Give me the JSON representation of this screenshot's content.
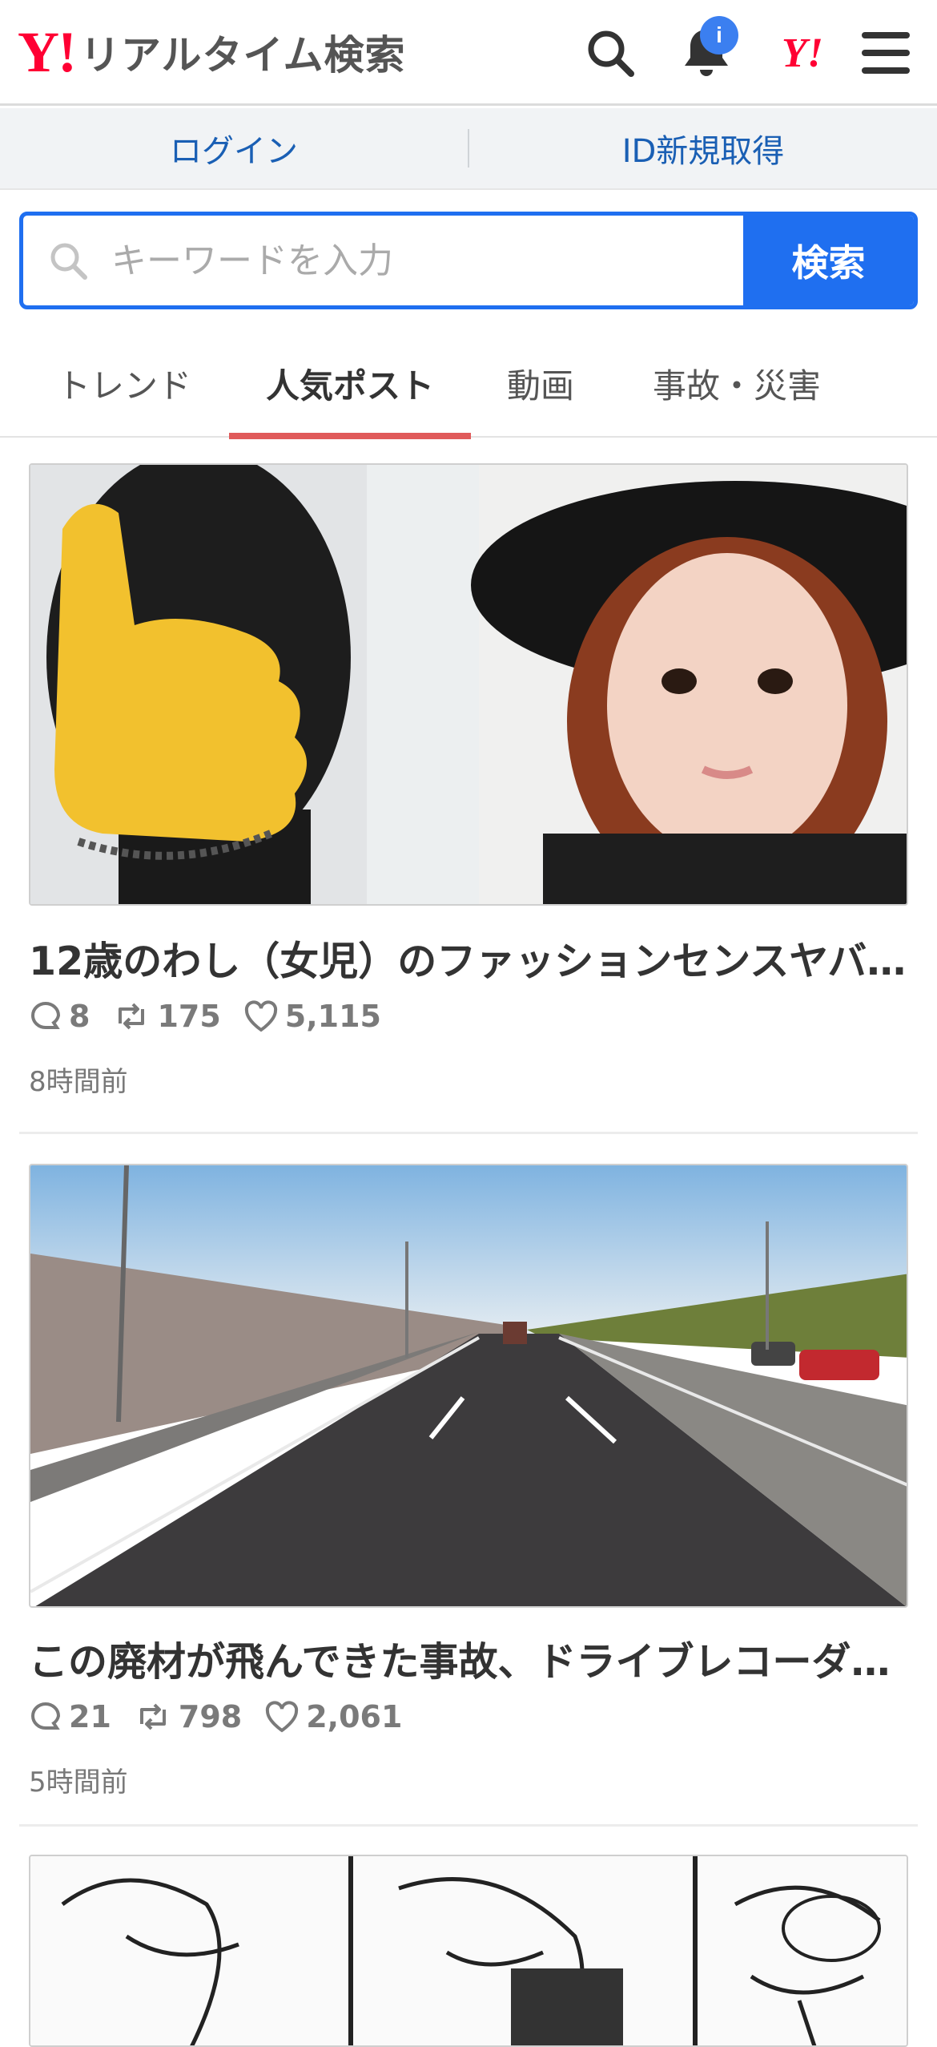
{
  "header": {
    "logo_mark": "Y!",
    "title": "リアルタイム検索",
    "notification_badge": "i",
    "yahoo_link": "Y!",
    "brand_color": "#ff0033"
  },
  "account": {
    "login": "ログイン",
    "register": "ID新規取得"
  },
  "search": {
    "placeholder": "キーワードを入力",
    "button": "検索",
    "accent": "#1f6ff0"
  },
  "tabs": [
    {
      "label": "トレンド",
      "active": false
    },
    {
      "label": "人気ポスト",
      "active": true
    },
    {
      "label": "動画",
      "active": false
    },
    {
      "label": "事故・災害",
      "active": false
    }
  ],
  "posts": [
    {
      "title": "12歳のわし（女児）のファッションセンスヤバ…",
      "replies": "8",
      "reposts": "175",
      "likes": "5,115",
      "time": "8時間前"
    },
    {
      "title": "この廃材が飛んできた事故、ドライブレコーダ…",
      "replies": "21",
      "reposts": "798",
      "likes": "2,061",
      "time": "5時間前"
    }
  ],
  "icons": [
    "search-icon",
    "bell-icon",
    "menu-icon",
    "reply-icon",
    "repost-icon",
    "like-icon"
  ]
}
